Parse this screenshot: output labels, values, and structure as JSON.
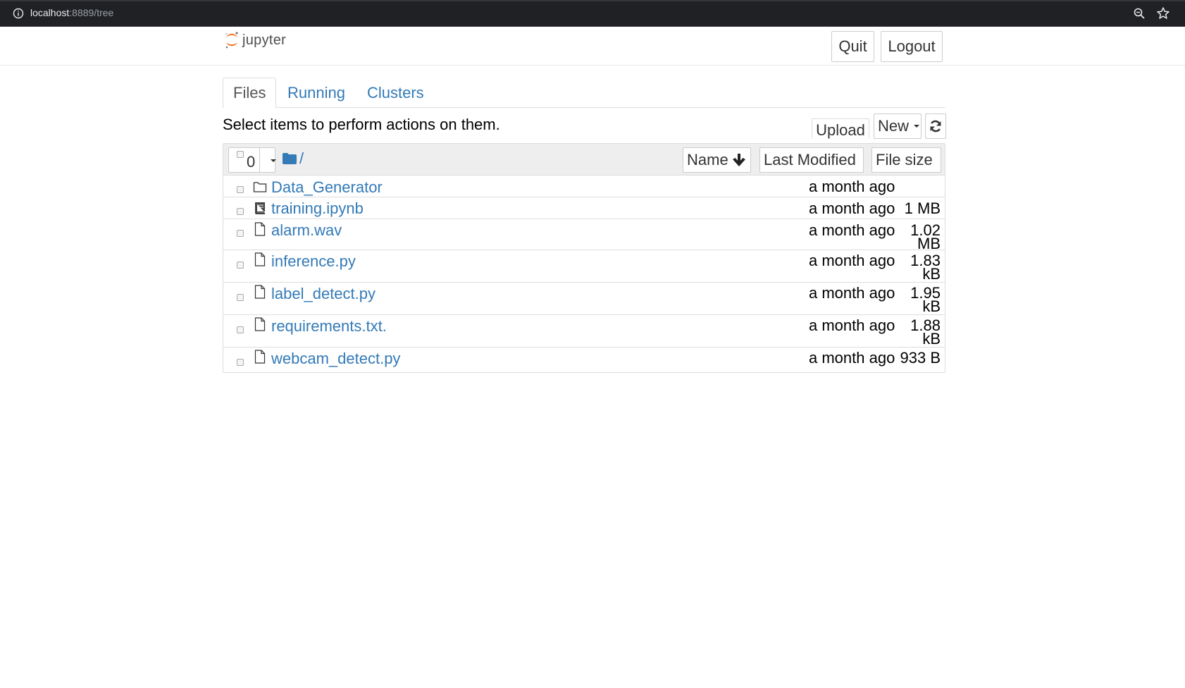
{
  "browser": {
    "url_host": "localhost",
    "url_path": ":8889/tree"
  },
  "header": {
    "logo_text": "jupyter",
    "quit_label": "Quit",
    "logout_label": "Logout"
  },
  "tabs": [
    {
      "label": "Files",
      "active": true
    },
    {
      "label": "Running",
      "active": false
    },
    {
      "label": "Clusters",
      "active": false
    }
  ],
  "toolbar": {
    "instructions": "Select items to perform actions on them.",
    "upload_label": "Upload",
    "new_label": "New",
    "refresh_icon": "refresh-icon"
  },
  "list_header": {
    "selected_count": "0",
    "path": "/",
    "sort_name": "Name",
    "sort_modified": "Last Modified",
    "sort_size": "File size"
  },
  "files": [
    {
      "name": "Data_Generator",
      "icon": "folder-icon",
      "modified": "a month ago",
      "size": ""
    },
    {
      "name": "training.ipynb",
      "icon": "notebook-icon",
      "modified": "a month ago",
      "size": "1 MB"
    },
    {
      "name": "alarm.wav",
      "icon": "file-icon",
      "modified": "a month ago",
      "size": "1.02 MB"
    },
    {
      "name": "inference.py",
      "icon": "file-icon",
      "modified": "a month ago",
      "size": "1.83 kB"
    },
    {
      "name": "label_detect.py",
      "icon": "file-icon",
      "modified": "a month ago",
      "size": "1.95 kB"
    },
    {
      "name": "requirements.txt.",
      "icon": "file-icon",
      "modified": "a month ago",
      "size": "1.88 kB"
    },
    {
      "name": "webcam_detect.py",
      "icon": "file-icon",
      "modified": "a month ago",
      "size": "933 B"
    }
  ],
  "colors": {
    "link": "#337ab7",
    "browser_bar": "#202124",
    "logo_orange": "#f37726"
  }
}
